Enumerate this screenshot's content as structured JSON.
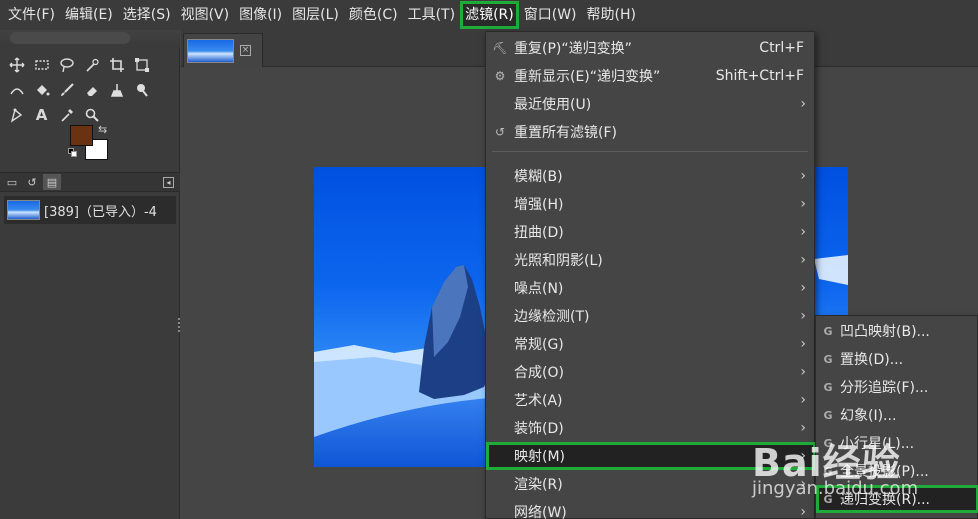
{
  "menubar": {
    "items": [
      "文件(F)",
      "编辑(E)",
      "选择(S)",
      "视图(V)",
      "图像(I)",
      "图层(L)",
      "颜色(C)",
      "工具(T)",
      "滤镜(R)",
      "窗口(W)",
      "帮助(H)"
    ]
  },
  "colors": {
    "foreground": "#6b3212",
    "background": "#ffffff",
    "highlight_outline": "#1faa3a"
  },
  "layers": {
    "row_label": "[389]（已导入）-4"
  },
  "filters_menu": {
    "repeat_label": "重复(P)“递归变换”",
    "repeat_shortcut": "Ctrl+F",
    "reshow_label": "重新显示(E)“递归变换”",
    "reshow_shortcut": "Shift+Ctrl+F",
    "recent_label": "最近使用(U)",
    "reset_label": "重置所有滤镜(F)",
    "items": [
      "模糊(B)",
      "增强(H)",
      "扭曲(D)",
      "光照和阴影(L)",
      "噪点(N)",
      "边缘检测(T)",
      "常规(G)",
      "合成(O)",
      "艺术(A)",
      "装饰(D)",
      "映射(M)",
      "渲染(R)",
      "网络(W)"
    ]
  },
  "map_submenu": {
    "items": [
      "凹凸映射(B)...",
      "置换(D)...",
      "分形追踪(F)...",
      "幻象(I)...",
      "小行星(L)...",
      "全景投影(P)...",
      "递归变换(R)..."
    ]
  },
  "icons": {
    "gegl_glyph": "G",
    "submenu_arrow": "›",
    "close_glyph": "×"
  },
  "watermark": {
    "brand": "Bai经验",
    "url": "jingyan.baidu.com"
  }
}
